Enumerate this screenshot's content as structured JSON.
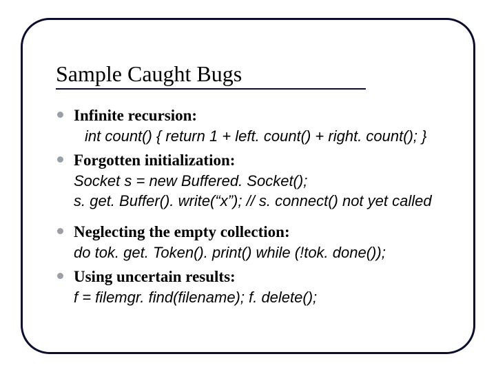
{
  "title": "Sample Caught Bugs",
  "items": [
    {
      "head": "Infinite recursion:",
      "lines": [
        "int count() { return 1 + left. count() + right. count(); }"
      ]
    },
    {
      "head": "Forgotten initialization:",
      "lines": [
        "Socket s = new Buffered. Socket();",
        "s. get. Buffer(). write(“x”);   // s. connect() not yet called"
      ]
    },
    {
      "head": "Neglecting the empty collection:",
      "lines": [
        "do tok. get. Token(). print() while (!tok. done());"
      ]
    },
    {
      "head": "Using uncertain results:",
      "lines": [
        "f = filemgr. find(filename); f. delete();"
      ]
    }
  ]
}
